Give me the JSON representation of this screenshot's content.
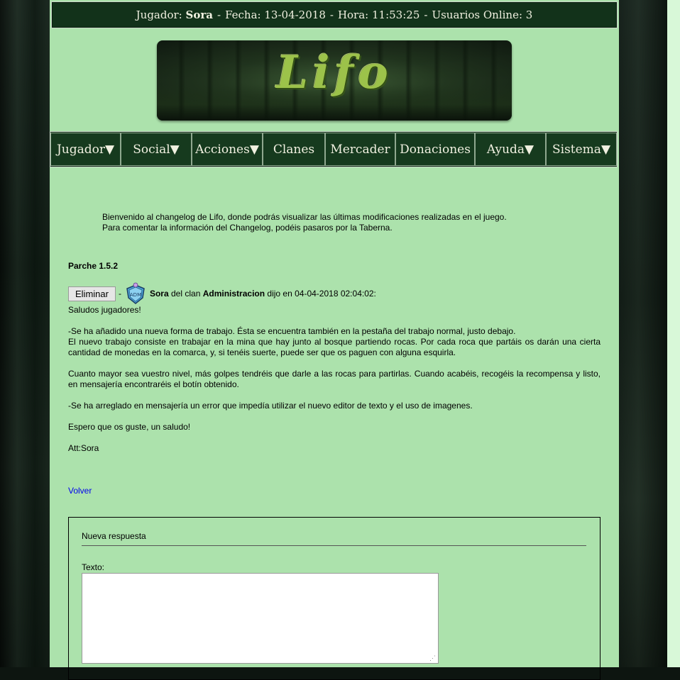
{
  "header": {
    "player_label": "Jugador:",
    "player_name": "Sora",
    "date_label": "Fecha:",
    "date_value": "13-04-2018",
    "time_label": "Hora:",
    "time_value": "11:53:25",
    "online_label": "Usuarios Online:",
    "online_value": "3",
    "separator": "-"
  },
  "banner": {
    "logo_text": "Lifo"
  },
  "nav": {
    "items": [
      {
        "label": "Jugador▼"
      },
      {
        "label": "Social▼"
      },
      {
        "label": "Acciones▼"
      },
      {
        "label": "Clanes"
      },
      {
        "label": "Mercader"
      },
      {
        "label": "Donaciones"
      },
      {
        "label": "Ayuda▼"
      },
      {
        "label": "Sistema▼"
      }
    ]
  },
  "intro": {
    "line1": "Bienvenido al changelog de Lifo, donde podrás visualizar las últimas modificaciones realizadas en el juego.",
    "line2": "Para comentar la información del Changelog, podéis pasaros por la Taberna."
  },
  "post": {
    "patch_title": "Parche 1.5.2",
    "delete_label": "Eliminar",
    "dash": "-",
    "badge_text": "ADM",
    "author": "Sora",
    "clan_prefix": "del clan",
    "clan": "Administracion",
    "said_on": "dijo en 04-04-2018 02:04:02:",
    "paragraphs": [
      "Saludos jugadores!",
      "-Se ha añadido una nueva forma de trabajo. Ésta se encuentra también en la pestaña del trabajo normal, justo debajo.",
      "El nuevo trabajo consiste en trabajar en la mina que hay junto al bosque partiendo rocas. Por cada roca que partáis os darán una cierta cantidad de monedas en la comarca, y, si tenéis suerte, puede ser que os paguen con alguna esquirla.",
      "Cuanto mayor sea vuestro nivel, más golpes tendréis que darle a las rocas para partirlas. Cuando acabéis, recogéis la recompensa y listo, en mensajería encontraréis el botín obtenido.",
      "-Se ha arreglado en mensajería un error que impedía utilizar el nuevo editor de texto y el uso de imagenes.",
      "Espero que os guste, un saludo!",
      "Att:Sora"
    ]
  },
  "back_link": "Volver",
  "reply": {
    "title": "Nueva respuesta",
    "text_label": "Texto:",
    "text_value": ""
  },
  "colors": {
    "page_bg": "#ace2ac",
    "header_bg": "#12321a",
    "nav_bg": "#163a1e",
    "link": "#0000ee"
  }
}
